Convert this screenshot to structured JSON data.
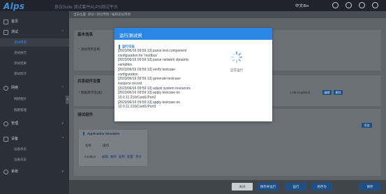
{
  "header": {
    "logo": "Alps",
    "title": "协议Suite  测试套件ALPS测试平台",
    "lang": "中文/En"
  },
  "sidebar": {
    "items": [
      {
        "label": "首页"
      },
      {
        "label": "测试"
      },
      {
        "label": "网络"
      },
      {
        "label": "管理"
      },
      {
        "label": "设备"
      },
      {
        "label": "系统"
      }
    ],
    "test_sub": [
      "测试用例",
      "测试执行",
      "测试结果",
      "测试统计"
    ],
    "net_sub": [
      "网络拓扑",
      "链路管理"
    ],
    "device_sub": [
      "设备状态",
      "设备日志"
    ]
  },
  "breadcrumb": "当前位置:  测试 / 测试用例 / 编辑测试用例",
  "basic_panel": {
    "title": "基本信息",
    "field_label": "* 测试用例名称:"
  },
  "shared_panel": {
    "title": "共享组件设置",
    "field_label": "* 数据库环境(类):",
    "lab_text": "LAB-loopback",
    "edit": "编辑",
    "delete": "删除"
  },
  "component_panel": {
    "title": "测试组件",
    "add": "添加"
  },
  "app_sim": {
    "title": "Application Simulator",
    "col_name": "名称",
    "col_ops": "操作",
    "row_name": "modbus",
    "ops": [
      "编辑",
      "删除",
      "复制",
      "配置",
      "更多"
    ]
  },
  "footer_buttons": [
    "关闭",
    "保存并运行",
    "运行",
    "另存为",
    "保存"
  ],
  "modal": {
    "title": "运行测试例",
    "log_label": "运行日志",
    "log_lines": [
      "[2023/06/16 09:59:13] parse test component",
      "configuration for 'modbus'",
      "[2023/06/16 09:59:13] parse network dynamic",
      "variables",
      "[2023/06/16 09:59:13] verify testcase",
      "configuration",
      "[2023/06/16 09:59:13] generate testcase",
      "instance record",
      "[2023/06/16 09:59:13] adjust system resources",
      "[2023/06/16 09:59:13] apply testcase on",
      "10.0.11.210/Card1/Port2",
      "[2023/06/16 09:59:13] apply testcase on",
      "10.0.11.210/Card1/Port3"
    ],
    "status": "正在运行"
  },
  "colors": {
    "accent": "#2a86e6",
    "sidebar": "#2b2f37",
    "topbar": "#20232b",
    "overlay": "#6f7479"
  }
}
